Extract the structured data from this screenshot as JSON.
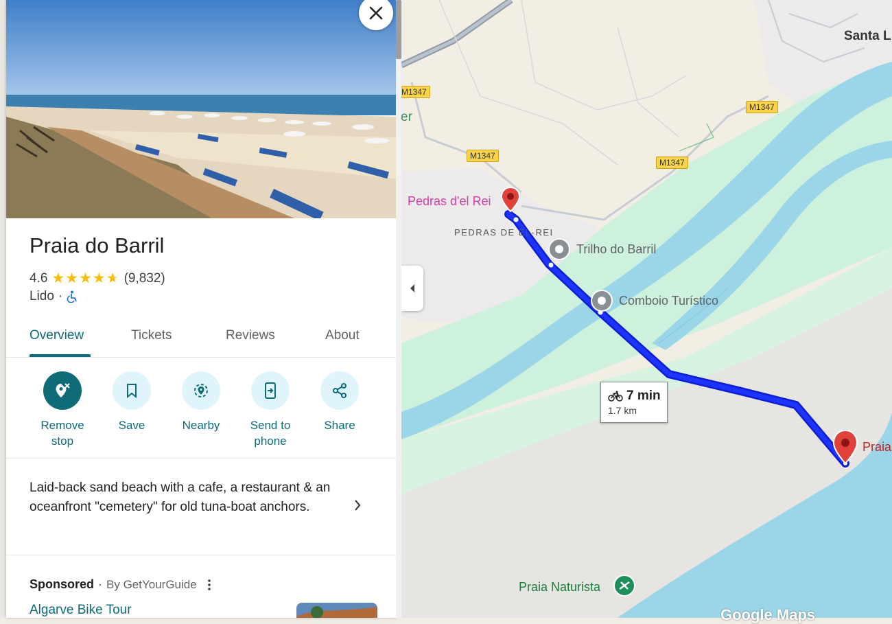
{
  "panel": {
    "place_name": "Praia do Barril",
    "rating": "4.6",
    "review_count": "(9,832)",
    "stars": 4.6,
    "category": "Lido",
    "separator": "·",
    "tabs": [
      {
        "label": "Overview",
        "active": true
      },
      {
        "label": "Tickets",
        "active": false
      },
      {
        "label": "Reviews",
        "active": false
      },
      {
        "label": "About",
        "active": false
      }
    ],
    "actions": [
      {
        "label": "Remove stop",
        "icon": "remove-stop-icon"
      },
      {
        "label": "Save",
        "icon": "bookmark-icon"
      },
      {
        "label": "Nearby",
        "icon": "nearby-icon"
      },
      {
        "label": "Send to phone",
        "icon": "send-to-phone-icon"
      },
      {
        "label": "Share",
        "icon": "share-icon"
      }
    ],
    "description": "Laid-back sand beach with a cafe, a restaurant & an oceanfront \"cemetery\" for old tuna-boat anchors.",
    "sponsored_label": "Sponsored",
    "sponsored_by": "By GetYourGuide",
    "tour_title": "Algarve Bike Tour"
  },
  "map": {
    "places": {
      "start": "Pedras d'el Rei",
      "area": "PEDRAS DE EL-REI",
      "trail": "Trilho do Barril",
      "train": "Comboio Turístico",
      "destination": "Praia",
      "naturist": "Praia Naturista",
      "town": "Santa L",
      "partial_label": "er"
    },
    "roads": [
      "M1347",
      "M1347",
      "M1347",
      "M1347"
    ],
    "route": {
      "duration": "7 min",
      "distance": "1.7 km",
      "mode": "bicycle-icon"
    },
    "attribution": "Google Maps"
  },
  "colors": {
    "accent": "#0b6b79",
    "route": "#1a2cf5",
    "water": "#9ad6e8",
    "park": "#c8f0d8",
    "sand": "#e8e6e2",
    "pin_red": "#e0413a",
    "pin_pink": "#d93aa8"
  }
}
